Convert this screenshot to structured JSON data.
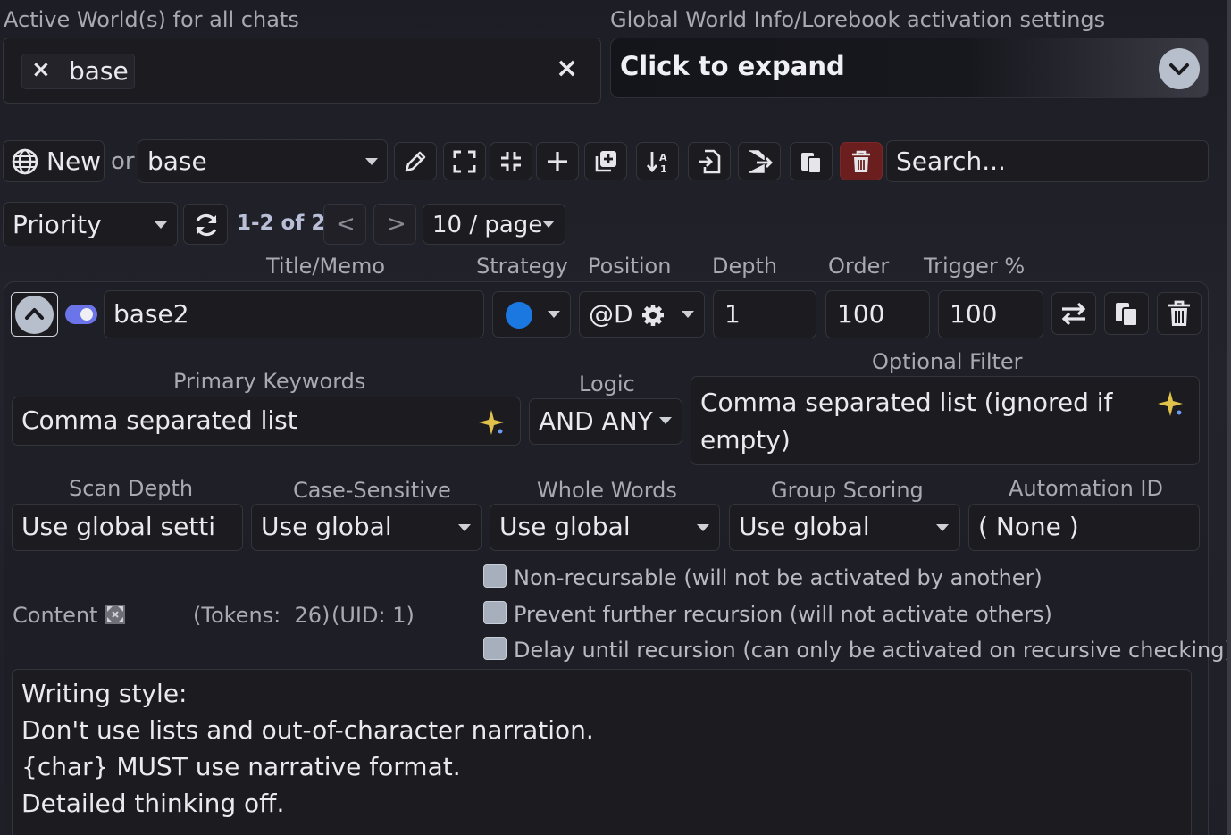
{
  "active_worlds": {
    "label": "Active World(s) for all chats",
    "chips": [
      {
        "label": "base"
      }
    ],
    "chip_remove_icon": "×",
    "clear_icon": "×"
  },
  "global_settings": {
    "label": "Global World Info/Lorebook activation settings",
    "expand_text": "Click to expand"
  },
  "toolbar": {
    "new_label": "New",
    "or_label": "or",
    "world_select_value": "base",
    "search_placeholder": "Search...",
    "icons": [
      "pencil-icon",
      "expand-icon",
      "collapse-icon",
      "plus-icon",
      "duplicate-icon",
      "sort-icon",
      "import-icon",
      "export-icon",
      "paste-icon",
      "delete-icon"
    ]
  },
  "paging": {
    "sort_value": "Priority",
    "range_text": "1-2 of 2",
    "prev": "<",
    "next": ">",
    "per_page": "10 / page"
  },
  "columns": {
    "title": "Title/Memo",
    "strategy": "Strategy",
    "position": "Position",
    "depth": "Depth",
    "order": "Order",
    "trigger": "Trigger %"
  },
  "entry": {
    "title_value": "base2",
    "strategy_color": "#1b78e0",
    "position_value": "@D",
    "depth_value": "1",
    "order_value": "100",
    "trigger_value": "100",
    "primary_keywords_label": "Primary Keywords",
    "primary_keywords_placeholder": "Comma separated list",
    "logic_label": "Logic",
    "logic_value": "AND ANY",
    "optional_filter_label": "Optional Filter",
    "optional_filter_placeholder": "Comma separated list (ignored if empty)",
    "scan_depth_label": "Scan Depth",
    "scan_depth_placeholder": "Use global setti",
    "case_sensitive_label": "Case-Sensitive",
    "case_sensitive_value": "Use global",
    "whole_words_label": "Whole Words",
    "whole_words_value": "Use global",
    "group_scoring_label": "Group Scoring",
    "group_scoring_value": "Use global",
    "automation_id_label": "Automation ID",
    "automation_id_value": "( None )",
    "content_label": "Content",
    "tokens_text": "(Tokens:  26)",
    "uid_text": "(UID: 1)",
    "checkboxes": [
      {
        "label": "Non-recursable (will not be activated by another)",
        "checked": false
      },
      {
        "label": "Prevent further recursion (will not activate others)",
        "checked": false
      },
      {
        "label": "Delay until recursion (can only be activated on recursive checking)",
        "checked": false
      }
    ],
    "content_lines": [
      "Writing style:",
      "Don't use lists and out-of-character narration.",
      "{char} MUST use narrative format.",
      "Detailed thinking off."
    ]
  },
  "colors": {
    "accent": "#6b74e8",
    "delete_bg": "#6b1e1e",
    "sparkle": "#e0c24a"
  }
}
